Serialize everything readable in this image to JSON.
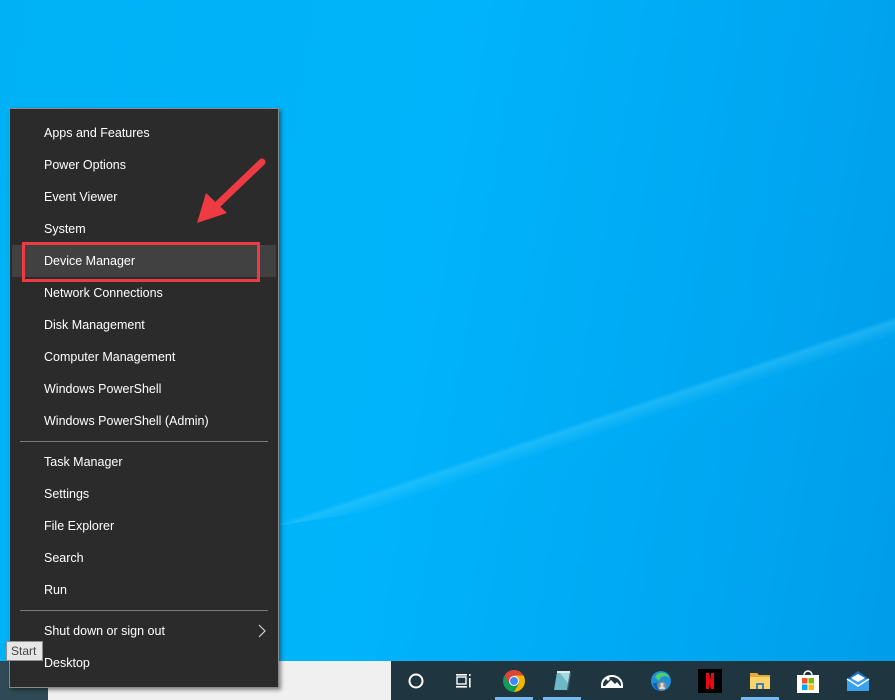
{
  "desktop": {
    "background_color": "#00b4fb"
  },
  "context_menu": {
    "groups": [
      {
        "items": [
          {
            "label": "Apps and Features"
          },
          {
            "label": "Power Options"
          },
          {
            "label": "Event Viewer"
          },
          {
            "label": "System"
          },
          {
            "label": "Device Manager",
            "highlighted": true
          },
          {
            "label": "Network Connections"
          },
          {
            "label": "Disk Management"
          },
          {
            "label": "Computer Management"
          },
          {
            "label": "Windows PowerShell"
          },
          {
            "label": "Windows PowerShell (Admin)"
          }
        ]
      },
      {
        "items": [
          {
            "label": "Task Manager"
          },
          {
            "label": "Settings"
          },
          {
            "label": "File Explorer"
          },
          {
            "label": "Search"
          },
          {
            "label": "Run"
          }
        ]
      },
      {
        "items": [
          {
            "label": "Shut down or sign out",
            "submenu": true,
            "submenu_icon": "chevron-right-icon"
          },
          {
            "label": "Desktop"
          }
        ]
      }
    ]
  },
  "annotation": {
    "highlight_target": "Device Manager",
    "color": "#ee3a43"
  },
  "tooltip": {
    "text": "Start"
  },
  "taskbar": {
    "search_placeholder": "",
    "icons": [
      {
        "name": "cortana-icon",
        "running": false
      },
      {
        "name": "task-view-icon",
        "running": false
      },
      {
        "name": "chrome-icon",
        "running": true
      },
      {
        "name": "notepad-icon",
        "running": true
      },
      {
        "name": "photos-icon",
        "running": false
      },
      {
        "name": "edge-icon",
        "running": false
      },
      {
        "name": "netflix-icon",
        "running": false
      },
      {
        "name": "file-explorer-icon",
        "running": true
      },
      {
        "name": "microsoft-store-icon",
        "running": false
      },
      {
        "name": "mail-icon",
        "running": false
      }
    ]
  }
}
